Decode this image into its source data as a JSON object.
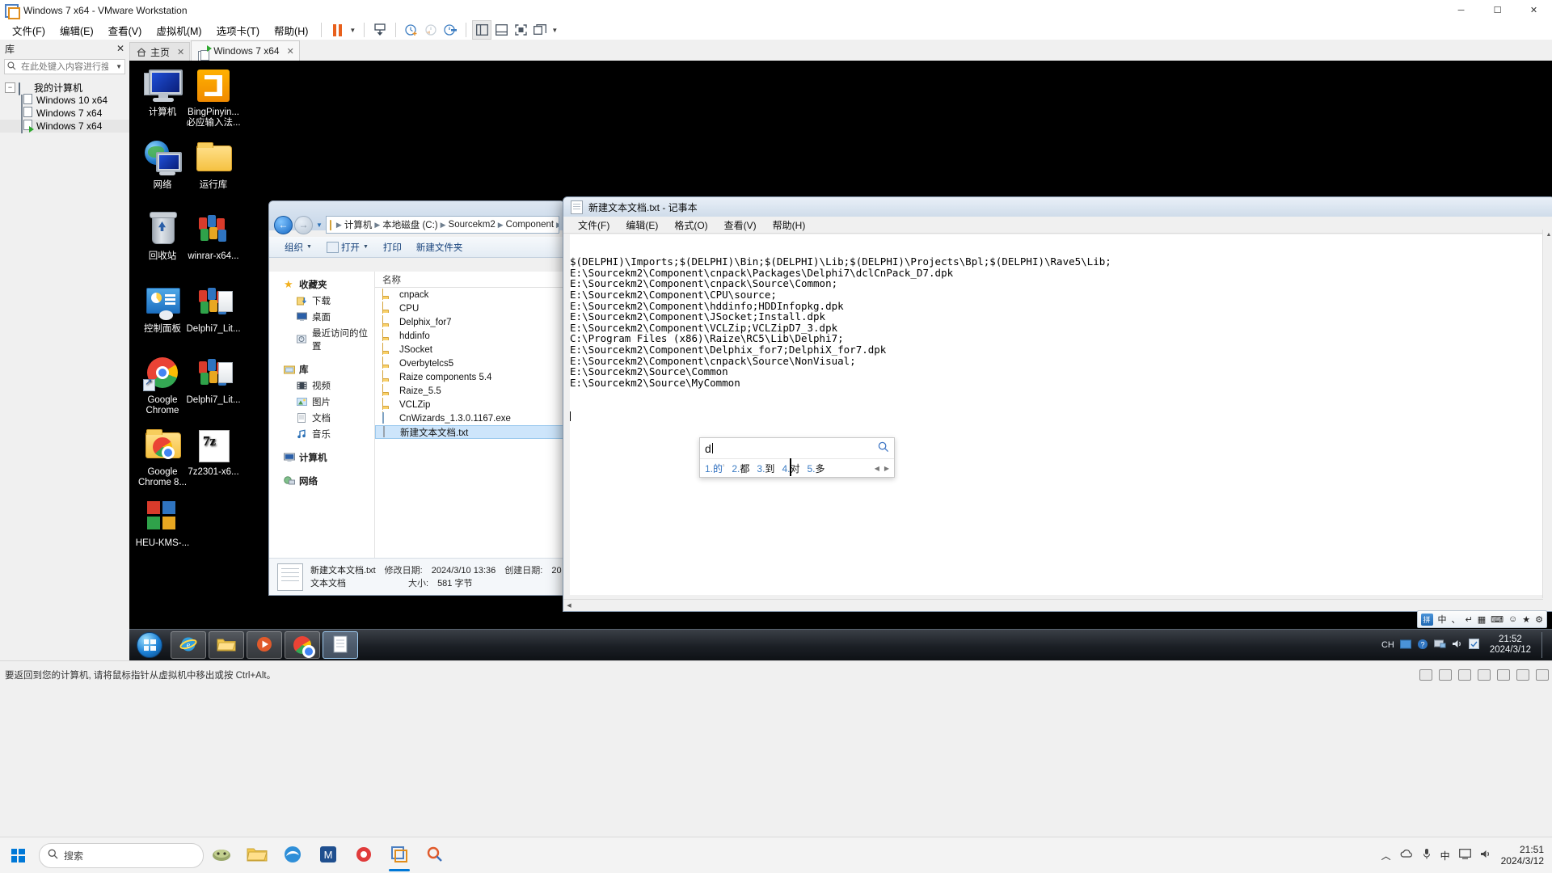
{
  "vmware": {
    "title": "Windows 7 x64 - VMware Workstation",
    "window_buttons": {
      "minimize": "─",
      "maximize": "☐",
      "close": "✕"
    },
    "menus": [
      "文件(F)",
      "编辑(E)",
      "查看(V)",
      "虚拟机(M)",
      "选项卡(T)",
      "帮助(H)"
    ],
    "toolbar_icons": [
      "pause-icon",
      "dropdown-caret-icon",
      "send-ctrl-alt-del-icon",
      "snapshot-take-icon",
      "snapshot-revert-icon",
      "snapshot-manager-icon",
      "show-library-icon",
      "show-thumbnails-icon",
      "full-screen-icon",
      "unity-mode-icon",
      "preferences-caret-icon"
    ],
    "status_hint": "要返回到您的计算机, 请将鼠标指针从虚拟机中移出或按 Ctrl+Alt。"
  },
  "library": {
    "title": "库",
    "close_label": "✕",
    "search_placeholder": "在此处键入内容进行搜索",
    "root": "我的计算机",
    "items": [
      {
        "label": "Windows 10 x64",
        "running": false
      },
      {
        "label": "Windows 7 x64",
        "running": false
      },
      {
        "label": "Windows 7 x64",
        "running": true
      }
    ]
  },
  "tabs": [
    {
      "label": "主页",
      "icon": "home-icon",
      "active": false,
      "close": "✕"
    },
    {
      "label": "Windows 7 x64",
      "icon": "vm-running-icon",
      "active": true,
      "close": "✕"
    }
  ],
  "desktop": {
    "icons": [
      {
        "label": "计算机",
        "icon": "computer-icon",
        "col": 0,
        "row": 0
      },
      {
        "label": "BingPinyin...\n必应输入法...",
        "line1": "BingPinyin...",
        "line2": "必应输入法...",
        "icon": "bing-pinyin-icon",
        "col": 1,
        "row": 0
      },
      {
        "label": "网络",
        "icon": "network-icon",
        "col": 0,
        "row": 1
      },
      {
        "label": "运行库",
        "icon": "folder-icon",
        "col": 1,
        "row": 1
      },
      {
        "label": "回收站",
        "icon": "recycle-bin-icon",
        "col": 0,
        "row": 2
      },
      {
        "label": "winrar-x64...",
        "icon": "winrar-icon",
        "col": 1,
        "row": 2
      },
      {
        "label": "控制面板",
        "icon": "control-panel-icon",
        "col": 0,
        "row": 3
      },
      {
        "label": "Delphi7_Lit...",
        "icon": "delphi-icon",
        "col": 1,
        "row": 3
      },
      {
        "label": "Google\nChrome",
        "line1": "Google",
        "line2": "Chrome",
        "icon": "chrome-icon",
        "col": 0,
        "row": 4
      },
      {
        "label": "Delphi7_Lit...",
        "icon": "delphi-icon",
        "col": 1,
        "row": 4
      },
      {
        "label": "Google\nChrome 8...",
        "line1": "Google",
        "line2": "Chrome 8...",
        "icon": "chrome-folder-icon",
        "col": 0,
        "row": 5
      },
      {
        "label": "7z2301-x6...",
        "icon": "7zip-icon",
        "col": 1,
        "row": 5
      },
      {
        "label": "HEU-KMS-...",
        "icon": "heu-kms-icon",
        "col": 0,
        "row": 6
      }
    ]
  },
  "explorer": {
    "breadcrumb": [
      "计算机",
      "本地磁盘 (C:)",
      "Sourcekm2",
      "Component"
    ],
    "commands": [
      "组织",
      "打开",
      "打印",
      "新建文件夹"
    ],
    "nav": {
      "favorites": {
        "label": "收藏夹",
        "items": [
          "下载",
          "桌面",
          "最近访问的位置"
        ]
      },
      "libraries": {
        "label": "库",
        "items": [
          "视频",
          "图片",
          "文档",
          "音乐"
        ]
      },
      "computer": {
        "label": "计算机"
      },
      "network": {
        "label": "网络"
      }
    },
    "column_header": "名称",
    "files": [
      {
        "name": "cnpack",
        "type": "folder",
        "selected": false
      },
      {
        "name": "CPU",
        "type": "folder",
        "selected": false
      },
      {
        "name": "Delphix_for7",
        "type": "folder",
        "selected": false
      },
      {
        "name": "hddinfo",
        "type": "folder",
        "selected": false
      },
      {
        "name": "JSocket",
        "type": "folder",
        "selected": false
      },
      {
        "name": "Overbytelcs5",
        "type": "folder",
        "selected": false
      },
      {
        "name": "Raize components 5.4",
        "type": "folder",
        "selected": false
      },
      {
        "name": "Raize_5.5",
        "type": "folder",
        "selected": false
      },
      {
        "name": "VCLZip",
        "type": "folder",
        "selected": false
      },
      {
        "name": "CnWizards_1.3.0.1167.exe",
        "type": "exe",
        "selected": false
      },
      {
        "name": "新建文本文档.txt",
        "type": "text",
        "selected": true
      }
    ],
    "status": {
      "filename": "新建文本文档.txt",
      "modified_label": "修改日期:",
      "modified_value": "2024/3/10 13:36",
      "created_label": "创建日期:",
      "created_value": "20",
      "type_label": "文本文档",
      "size_label": "大小:",
      "size_value": "581 字节"
    }
  },
  "notepad": {
    "title": "新建文本文档.txt - 记事本",
    "menus": [
      "文件(F)",
      "编辑(E)",
      "格式(O)",
      "查看(V)",
      "帮助(H)"
    ],
    "lines": [
      "$(DELPHI)\\Imports;$(DELPHI)\\Bin;$(DELPHI)\\Lib;$(DELPHI)\\Projects\\Bpl;$(DELPHI)\\Rave5\\Lib;",
      "E:\\Sourcekm2\\Component\\cnpack\\Packages\\Delphi7\\dclCnPack_D7.dpk",
      "E:\\Sourcekm2\\Component\\cnpack\\Source\\Common;",
      "E:\\Sourcekm2\\Component\\CPU\\source;",
      "E:\\Sourcekm2\\Component\\hddinfo;HDDInfopkg.dpk",
      "E:\\Sourcekm2\\Component\\JSocket;Install.dpk",
      "E:\\Sourcekm2\\Component\\VCLZip;VCLZipD7_3.dpk",
      "C:\\Program Files (x86)\\Raize\\RC5\\Lib\\Delphi7;",
      "E:\\Sourcekm2\\Component\\Delphix_for7;DelphiX_for7.dpk",
      "E:\\Sourcekm2\\Component\\cnpack\\Source\\NonVisual;",
      "E:\\Sourcekm2\\Source\\Common",
      "E:\\Sourcekm2\\Source\\MyCommon"
    ]
  },
  "ime": {
    "typed": "d",
    "search_icon": "magnifier-icon",
    "candidates": [
      {
        "num": "1.",
        "word": "的",
        "sup": "¹"
      },
      {
        "num": "2.",
        "word": "都"
      },
      {
        "num": "3.",
        "word": "到"
      },
      {
        "num": "4.",
        "word": "对"
      },
      {
        "num": "5.",
        "word": "多"
      }
    ],
    "prev_arrow": "◀",
    "next_arrow": "▶"
  },
  "guest_taskbar": {
    "start_icon": "windows-orb-icon",
    "pinned": [
      "internet-explorer-icon",
      "explorer-icon",
      "media-player-icon",
      "chrome-icon",
      "notepad-icon"
    ],
    "tray": {
      "lang": "CH",
      "icons": [
        "ime-icon",
        "help-icon",
        "network-icon",
        "volume-icon",
        "action-center-icon",
        "show-desktop-icon"
      ],
      "time": "21:52",
      "date": "2024/3/12"
    },
    "langbar": {
      "items": [
        "中",
        "、",
        "↵",
        "▦",
        "⌨",
        "☺",
        "★",
        "⚙"
      ],
      "mode_label": "中"
    }
  },
  "host_taskbar": {
    "start_icon": "windows-start-icon",
    "search_placeholder": "搜索",
    "search_icon": "search-icon",
    "apps": [
      "cortana-icon",
      "file-explorer-icon",
      "edge-icon",
      "app-icon",
      "record-icon",
      "vmware-icon",
      "search-app-icon"
    ],
    "tray": {
      "expand_icon": "chevron-up-icon",
      "icons": [
        "onedrive-icon",
        "mic-icon",
        "ime-icon",
        "screen-icon",
        "volume-icon"
      ],
      "lang": "中",
      "time": "21:51",
      "date": "2024/3/12"
    }
  }
}
